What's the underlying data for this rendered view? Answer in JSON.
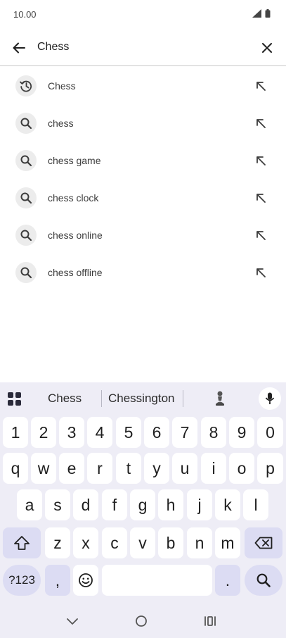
{
  "status_bar": {
    "time": "10.00",
    "signal_icon": "signal-icon",
    "battery_icon": "battery-icon"
  },
  "search": {
    "query": "Chess",
    "back_icon": "arrow-back-icon",
    "clear_icon": "close-icon"
  },
  "suggestions": [
    {
      "label": "Chess",
      "icon": "history-icon"
    },
    {
      "label": "chess",
      "icon": "search-icon"
    },
    {
      "label": "chess game",
      "icon": "search-icon"
    },
    {
      "label": "chess clock",
      "icon": "search-icon"
    },
    {
      "label": "chess online",
      "icon": "search-icon"
    },
    {
      "label": "chess offline",
      "icon": "search-icon"
    }
  ],
  "keyboard": {
    "word_suggestions": [
      "Chess",
      "Chessington"
    ],
    "emoji_suggestion": "chess-pawn-icon",
    "number_row": [
      "1",
      "2",
      "3",
      "4",
      "5",
      "6",
      "7",
      "8",
      "9",
      "0"
    ],
    "row1": [
      "q",
      "w",
      "e",
      "r",
      "t",
      "y",
      "u",
      "i",
      "o",
      "p"
    ],
    "row2": [
      "a",
      "s",
      "d",
      "f",
      "g",
      "h",
      "j",
      "k",
      "l"
    ],
    "row3": [
      "z",
      "x",
      "c",
      "v",
      "b",
      "n",
      "m"
    ],
    "symbols_key": "?123",
    "comma_key": ",",
    "period_key": ".",
    "emoji_key": "emoji-icon",
    "enter_key": "search-icon",
    "shift_key": "shift-icon",
    "backspace_key": "backspace-icon"
  },
  "nav_bar": {
    "back": "chevron-down-icon",
    "home": "home-circle-icon",
    "recents": "recents-icon"
  }
}
